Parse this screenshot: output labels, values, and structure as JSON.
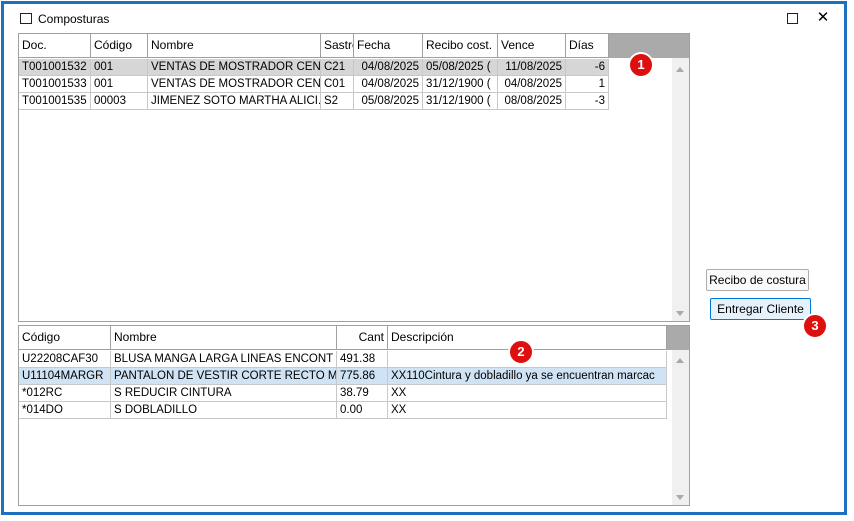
{
  "window": {
    "title": "Composturas",
    "maximize_icon": "maximize-icon",
    "close_label": "✕"
  },
  "docs_grid": {
    "columns": [
      "Doc.",
      "Código",
      "Nombre",
      "Sastre",
      "Fecha",
      "Recibo cost.",
      "Vence",
      "Días"
    ],
    "rows": [
      [
        "T001001532",
        "001",
        "VENTAS DE MOSTRADOR CENT",
        "C21",
        "04/08/2025",
        "05/08/2025 (",
        "11/08/2025",
        "-6"
      ],
      [
        "T001001533",
        "001",
        "VENTAS DE MOSTRADOR CENT",
        "C01",
        "04/08/2025",
        "31/12/1900 (",
        "04/08/2025",
        "1"
      ],
      [
        "T001001535",
        "00003",
        "JIMENEZ SOTO MARTHA ALICI.",
        "S2",
        "05/08/2025",
        "31/12/1900 (",
        "08/08/2025",
        "-3"
      ]
    ],
    "selected_row": 0
  },
  "items_grid": {
    "columns": [
      "Código",
      "Nombre",
      "Cant",
      "Descripción"
    ],
    "rows": [
      [
        "U22208CAF30",
        "BLUSA MANGA LARGA LINEAS ENCONT",
        "491.38",
        ""
      ],
      [
        "U11104MARGR",
        "PANTALON DE VESTIR CORTE RECTO M",
        "775.86",
        "XX110Cintura y dobladillo ya se encuentran marcac"
      ],
      [
        "*012RC",
        "S REDUCIR CINTURA",
        "38.79",
        "XX"
      ],
      [
        "*014DO",
        "S DOBLADILLO",
        "0.00",
        "XX"
      ]
    ],
    "selected_row": 1
  },
  "buttons": {
    "recibo": "Recibo de costura",
    "entregar": "Entregar Cliente"
  },
  "badges": [
    "1",
    "2",
    "3"
  ],
  "colors": {
    "window_border": "#1f6fc0",
    "badge": "#dd0f0f",
    "selected_row_gray": "#d6d6d6",
    "selected_row_blue": "#cfe3f5",
    "primary_button_border": "#0078d7"
  }
}
